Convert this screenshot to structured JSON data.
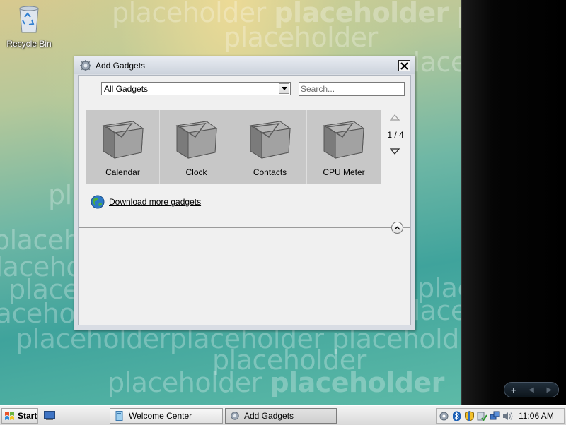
{
  "desktop": {
    "watermark_text": "placeholder",
    "recycle_bin_label": "Recycle Bin"
  },
  "dialog": {
    "title": "Add Gadgets",
    "close_label": "✕",
    "category_dropdown_value": "All Gadgets",
    "search_placeholder": "Search...",
    "gadgets": [
      {
        "name": "Calendar",
        "icon": "envelope-box-icon"
      },
      {
        "name": "Clock",
        "icon": "envelope-box-icon"
      },
      {
        "name": "Contacts",
        "icon": "envelope-box-icon"
      },
      {
        "name": "CPU Meter",
        "icon": "envelope-box-icon"
      }
    ],
    "page_indicator": "1 / 4",
    "download_link": "Download more gadgets"
  },
  "sidebar": {
    "add_label": "+",
    "prev_label": "◀",
    "next_label": "▶"
  },
  "taskbar": {
    "start_label": "Start",
    "tasks": [
      {
        "label": "Welcome Center",
        "active": false
      },
      {
        "label": "Add Gadgets",
        "active": true
      }
    ],
    "clock": "11:06 AM"
  },
  "colors": {
    "sidebar_bg": "#000000",
    "dialog_frame": "#d9dde4",
    "gallery_bg": "#c7c7c7"
  }
}
